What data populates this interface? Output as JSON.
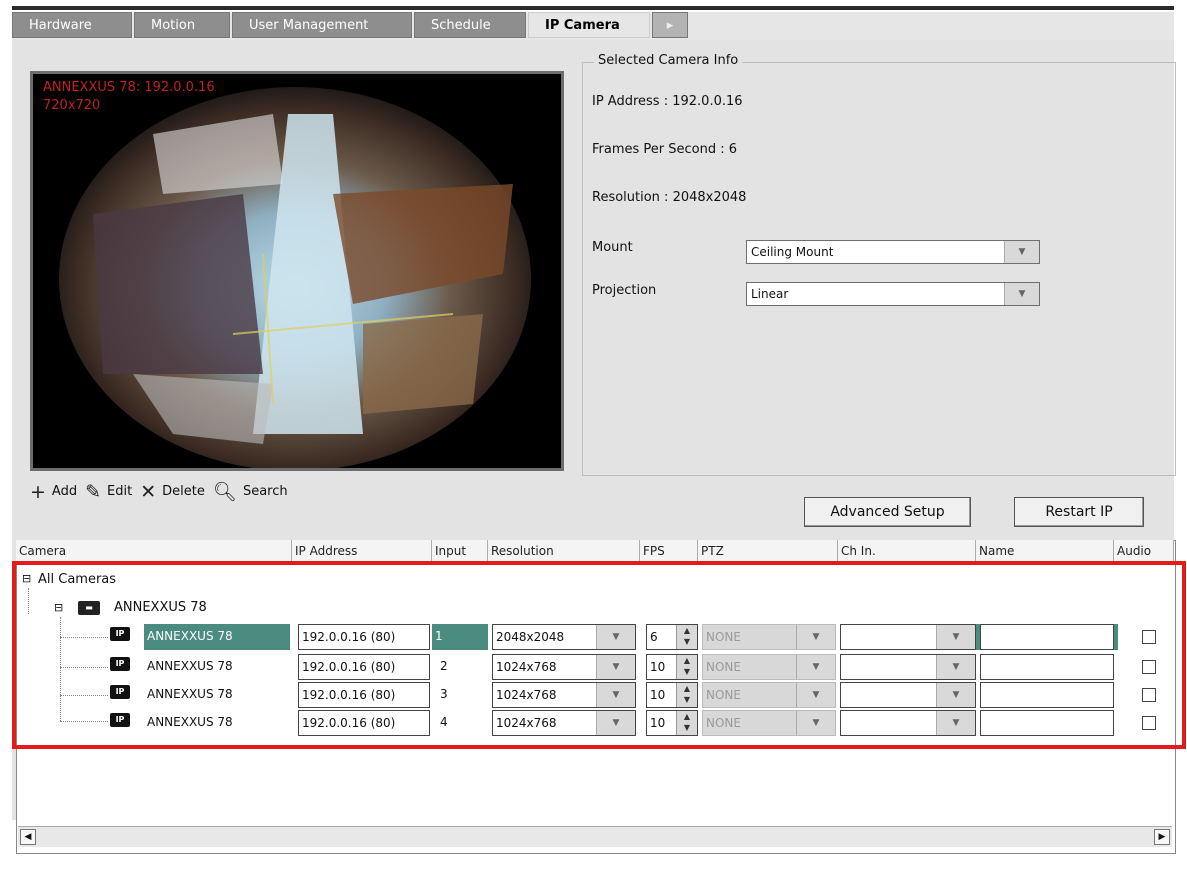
{
  "tabs": [
    {
      "label": "Hardware"
    },
    {
      "label": "Motion"
    },
    {
      "label": "User Management"
    },
    {
      "label": "Schedule"
    },
    {
      "label": "IP Camera",
      "active": true
    }
  ],
  "preview": {
    "overlay_line1": "ANNEXXUS 78: 192.0.0.16",
    "overlay_line2": "720x720"
  },
  "camera_info": {
    "title": "Selected Camera Info",
    "ip_address": "IP Address : 192.0.0.16",
    "fps": "Frames Per Second : 6",
    "resolution": "Resolution : 2048x2048",
    "mount_label": "Mount",
    "mount_value": "Ceiling Mount",
    "projection_label": "Projection",
    "projection_value": "Linear"
  },
  "toolbar": {
    "add": "Add",
    "edit": "Edit",
    "delete": "Delete",
    "search": "Search"
  },
  "buttons": {
    "advanced_setup": "Advanced Setup",
    "restart_ip": "Restart IP"
  },
  "columns": [
    "Camera",
    "IP Address",
    "Input",
    "Resolution",
    "FPS",
    "PTZ",
    "Ch In.",
    "Name",
    "Audio"
  ],
  "tree": {
    "root": "All Cameras",
    "device": "ANNEXXUS 78"
  },
  "rows": [
    {
      "camera": "ANNEXXUS 78",
      "ip": "192.0.0.16 (80)",
      "input": "1",
      "resolution": "2048x2048",
      "fps": "6",
      "ptz": "NONE",
      "selected": true
    },
    {
      "camera": "ANNEXXUS 78",
      "ip": "192.0.0.16 (80)",
      "input": "2",
      "resolution": "1024x768",
      "fps": "10",
      "ptz": "NONE",
      "selected": false
    },
    {
      "camera": "ANNEXXUS 78",
      "ip": "192.0.0.16 (80)",
      "input": "3",
      "resolution": "1024x768",
      "fps": "10",
      "ptz": "NONE",
      "selected": false
    },
    {
      "camera": "ANNEXXUS 78",
      "ip": "192.0.0.16 (80)",
      "input": "4",
      "resolution": "1024x768",
      "fps": "10",
      "ptz": "NONE",
      "selected": false
    }
  ],
  "colors": {
    "highlight_border": "#e21b1b",
    "selected_row": "#4a8c80"
  }
}
